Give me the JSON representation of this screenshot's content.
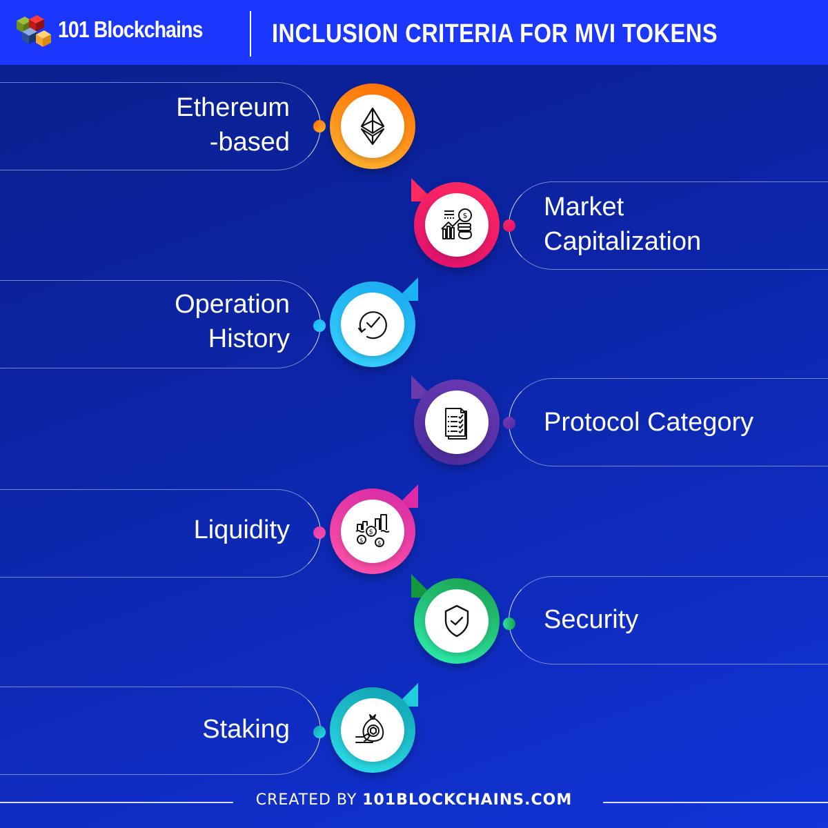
{
  "header": {
    "brand": "101 Blockchains",
    "title": "INCLUSION CRITERIA FOR MVI TOKENS"
  },
  "criteria": [
    {
      "lines": [
        "Ethereum",
        "-based"
      ],
      "icon": "ethereum-icon",
      "side": "left",
      "color_start": "#ff6a00",
      "color_end": "#ffb733"
    },
    {
      "lines": [
        "Market",
        "Capitalization"
      ],
      "icon": "market-cap-icon",
      "side": "right",
      "color_start": "#ff2a5f",
      "color_end": "#e0106e"
    },
    {
      "lines": [
        "Operation",
        "History"
      ],
      "icon": "clock-history-icon",
      "side": "left",
      "color_start": "#1bb5f5",
      "color_end": "#2fd3ff"
    },
    {
      "lines": [
        "Protocol Category"
      ],
      "icon": "checklist-document-icon",
      "side": "right",
      "color_start": "#7a3db8",
      "color_end": "#4b2aa0"
    },
    {
      "lines": [
        "Liquidity"
      ],
      "icon": "liquidity-icon",
      "side": "left",
      "color_start": "#e33bb5",
      "color_end": "#ff4da6"
    },
    {
      "lines": [
        "Security"
      ],
      "icon": "shield-check-icon",
      "side": "right",
      "color_start": "#15a046",
      "color_end": "#2ef0b0"
    },
    {
      "lines": [
        "Staking"
      ],
      "icon": "staking-money-bag-icon",
      "side": "left",
      "color_start": "#0fa3b5",
      "color_end": "#27e0e8"
    }
  ],
  "footer": {
    "prefix": "CREATED BY ",
    "site": "101BLOCKCHAINS.COM"
  }
}
